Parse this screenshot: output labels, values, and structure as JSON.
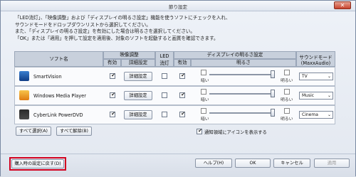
{
  "window": {
    "title": "節り設定",
    "close_label": "✕"
  },
  "description": {
    "line1": "「LED消灯」、「映像調整」および「ディスプレイの明るさ設定」機能を使うソフトにチェックを入れ、",
    "line2": "サウンドモードをドロップダウンリストから選択してください。",
    "line3": "また、「ディスプレイの明るさ設定」を有効にした場合は明るさを選択してください。",
    "line4": "「OK」または「適用」を押して設定を適用後、対象のソフトを起動すると画質を確認できます。"
  },
  "table": {
    "headers": {
      "soft_name": "ソフト名",
      "video_adjust": "映像調整",
      "enable": "有効",
      "detail": "詳細設定",
      "led_line1": "LED",
      "led_line2": "消灯",
      "display_brightness": "ディスプレイの明るさ設定",
      "enable2": "有効",
      "brightness": "明るさ",
      "sound_mode_line1": "サウンドモード",
      "sound_mode_line2": "(MaxxAudio)"
    },
    "rows": [
      {
        "name": "SmartVision",
        "detail_btn": "詳細設定",
        "video_enabled": true,
        "led_off": false,
        "disp_enabled": true,
        "dark": "暗い",
        "bright": "明るい",
        "sound": "TV",
        "brightness_level": 0.95
      },
      {
        "name": "Windows Media Player",
        "detail_btn": "詳細設定",
        "video_enabled": true,
        "led_off": false,
        "disp_enabled": true,
        "dark": "暗い",
        "bright": "明るい",
        "sound": "Music",
        "brightness_level": 0.95
      },
      {
        "name": "CyberLink PowerDVD",
        "detail_btn": "詳細設定",
        "video_enabled": true,
        "led_off": false,
        "disp_enabled": true,
        "dark": "暗い",
        "bright": "明るい",
        "sound": "Cinema",
        "brightness_level": 0.95
      }
    ]
  },
  "actions": {
    "select_all": "すべて選択(A)",
    "deselect_all": "すべて解除(B)",
    "tray_icon_label": "通知領域にアイコンを表示する",
    "tray_icon_checked": true,
    "restore_defaults": "購入時の設定に戻す(D)",
    "help": "ヘルプ(H)",
    "ok": "OK",
    "cancel": "キャンセル",
    "apply": "適用"
  },
  "colors": {
    "highlight_box": "#d2001f"
  },
  "icons": {
    "check": "✔",
    "dropdown": "⌄"
  }
}
